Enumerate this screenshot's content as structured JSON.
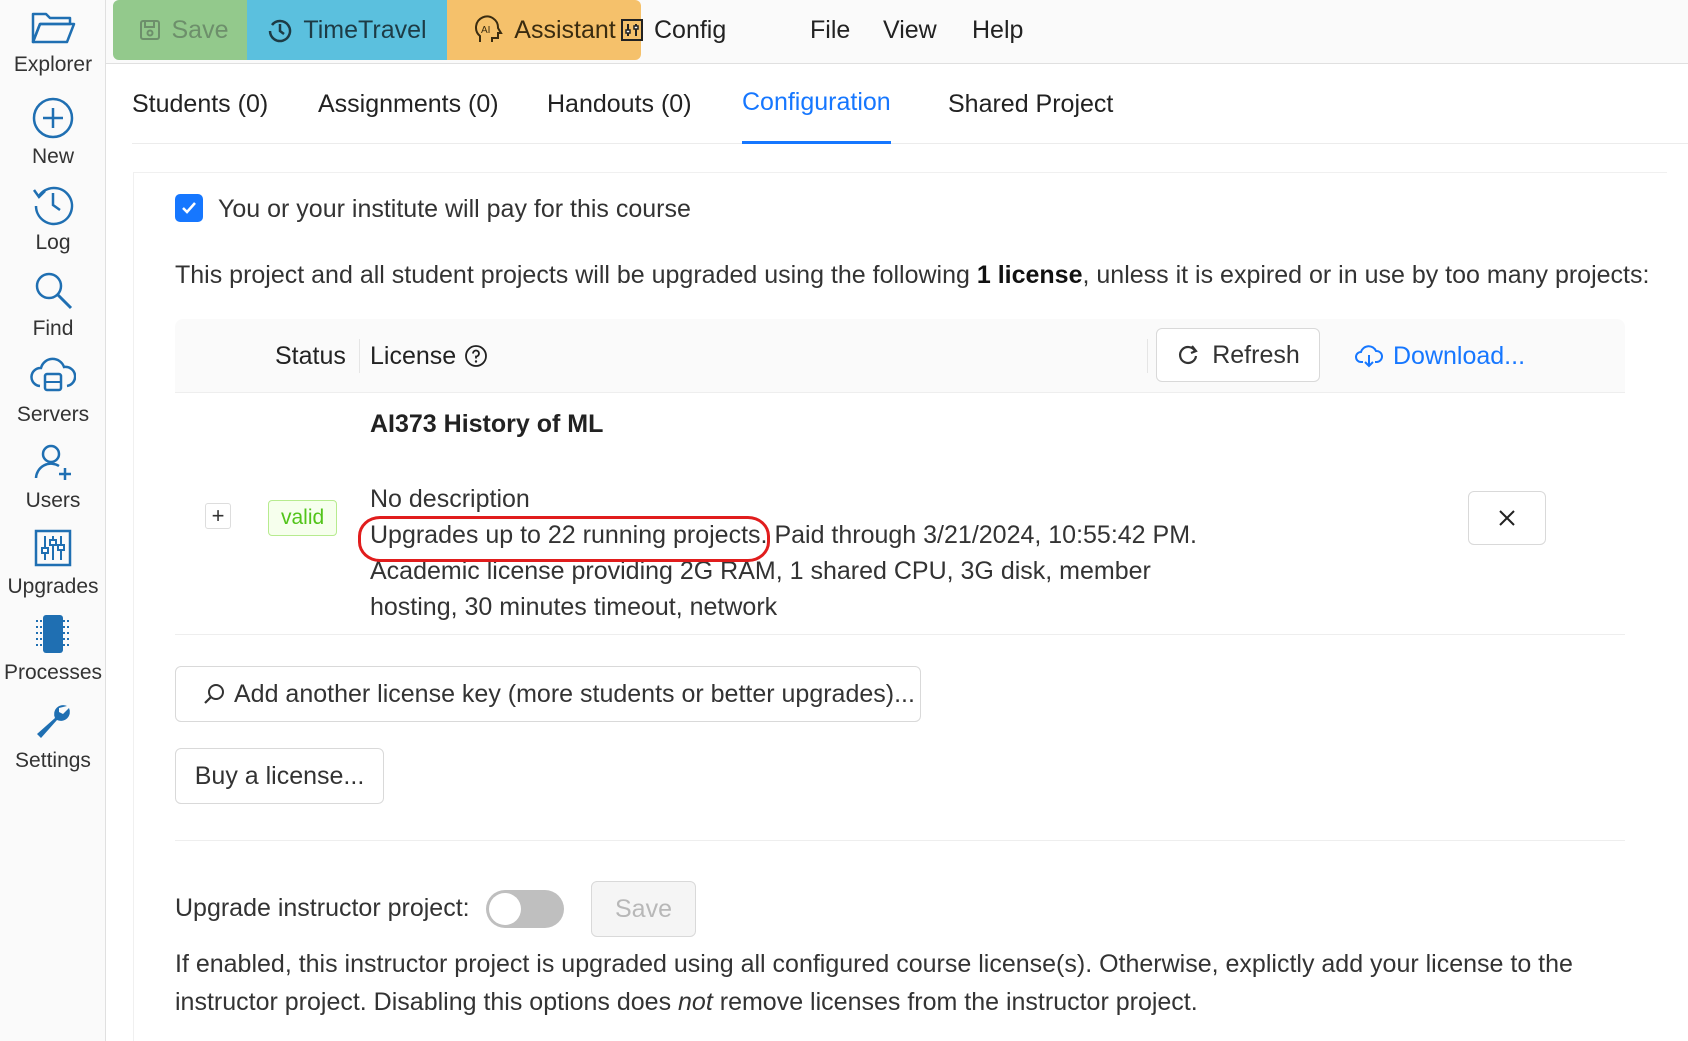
{
  "sidebar": {
    "items": [
      {
        "label": "Explorer",
        "icon": "folder-open-icon"
      },
      {
        "label": "New",
        "icon": "plus-circle-icon"
      },
      {
        "label": "Log",
        "icon": "history-icon"
      },
      {
        "label": "Find",
        "icon": "search-icon"
      },
      {
        "label": "Servers",
        "icon": "cloud-server-icon"
      },
      {
        "label": "Users",
        "icon": "users-add-icon"
      },
      {
        "label": "Upgrades",
        "icon": "sliders-icon"
      },
      {
        "label": "Processes",
        "icon": "chip-icon"
      },
      {
        "label": "Settings",
        "icon": "wrench-icon"
      }
    ]
  },
  "toolbar": {
    "save_label": "Save",
    "timetravel_label": "TimeTravel",
    "assistant_label": "Assistant",
    "menu": [
      "Config",
      "File",
      "View",
      "Help"
    ]
  },
  "tabs": [
    {
      "label": "Students (0)"
    },
    {
      "label": "Assignments (0)"
    },
    {
      "label": "Handouts (0)"
    },
    {
      "label": "Configuration"
    },
    {
      "label": "Shared Project"
    }
  ],
  "config": {
    "pay_label": "You or your institute will pay for this course",
    "pay_checked": true,
    "upgrade_prefix": "This project and all student projects will be upgraded using the following ",
    "upgrade_count": "1 license",
    "upgrade_suffix": ", unless it is expired or in use by too many projects:",
    "table": {
      "status_header": "Status",
      "license_header": "License",
      "refresh_label": "Refresh",
      "download_label": "Download..."
    },
    "license": {
      "title": "AI373 History of ML",
      "status": "valid",
      "description": "No description",
      "upgrades": "Upgrades up to 22 running projects.",
      "paid_through": "Paid through 3/21/2024, 10:55:42 PM.",
      "details_line1": "Academic license providing 2G RAM, 1 shared CPU, 3G disk, member",
      "details_line2": "hosting, 30 minutes timeout, network"
    },
    "add_key_label": "Add another license key (more students or better upgrades)...",
    "buy_label": "Buy a license...",
    "upgrade_instructor_label": "Upgrade instructor project:",
    "upgrade_instructor_enabled": false,
    "instructor_save_label": "Save",
    "info_part1": "If enabled, this instructor project is upgraded using all configured course license(s). Otherwise, explictly add your license to the instructor project. Disabling this options does ",
    "info_emph": "not",
    "info_part2": " remove licenses from the instructor project."
  },
  "colors": {
    "accent": "#1677ff",
    "save_bg": "#93c98c",
    "timetravel_bg": "#5bc0de",
    "assistant_bg": "#f5c16b",
    "highlight": "#e11d1d",
    "valid": "#52c41a"
  }
}
